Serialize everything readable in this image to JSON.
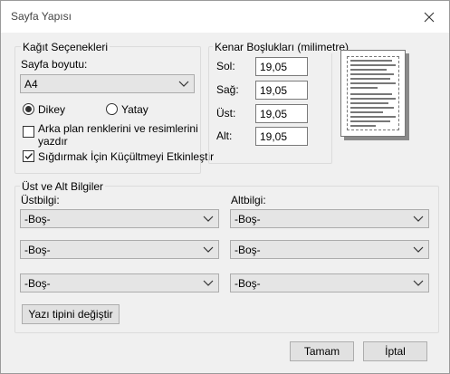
{
  "window": {
    "title": "Sayfa Yapısı"
  },
  "paper_options": {
    "label": "Kağıt Seçenekleri",
    "paper_size_label": "Sayfa boyutu:",
    "paper_size_value": "A4",
    "portrait_label": "Dikey",
    "landscape_label": "Yatay",
    "print_background_label_line1": "Arka plan renklerini ve resimlerini",
    "print_background_label_line2": "yazdır",
    "shrink_to_fit_label": "Sığdırmak İçin Küçültmeyi Etkinleştir",
    "portrait_selected": true,
    "print_background_checked": false,
    "shrink_to_fit_checked": true
  },
  "margins": {
    "label": "Kenar Boşlukları (milimetre)",
    "left_label": "Sol:",
    "right_label": "Sağ:",
    "top_label": "Üst:",
    "bottom_label": "Alt:",
    "left_value": "19,05",
    "right_value": "19,05",
    "top_value": "19,05",
    "bottom_value": "19,05"
  },
  "headers_footers": {
    "label": "Üst ve Alt Bilgiler",
    "header_label": "Üstbilgi:",
    "footer_label": "Altbilgi:",
    "header_values": [
      "-Boş-",
      "-Boş-",
      "-Boş-"
    ],
    "footer_values": [
      "-Boş-",
      "-Boş-",
      "-Boş-"
    ],
    "change_font_label": "Yazı tipini değiştir"
  },
  "buttons": {
    "ok_label": "Tamam",
    "cancel_label": "İptal"
  },
  "icons": {
    "close": "close-icon",
    "dropdown": "chevron-down-icon"
  }
}
